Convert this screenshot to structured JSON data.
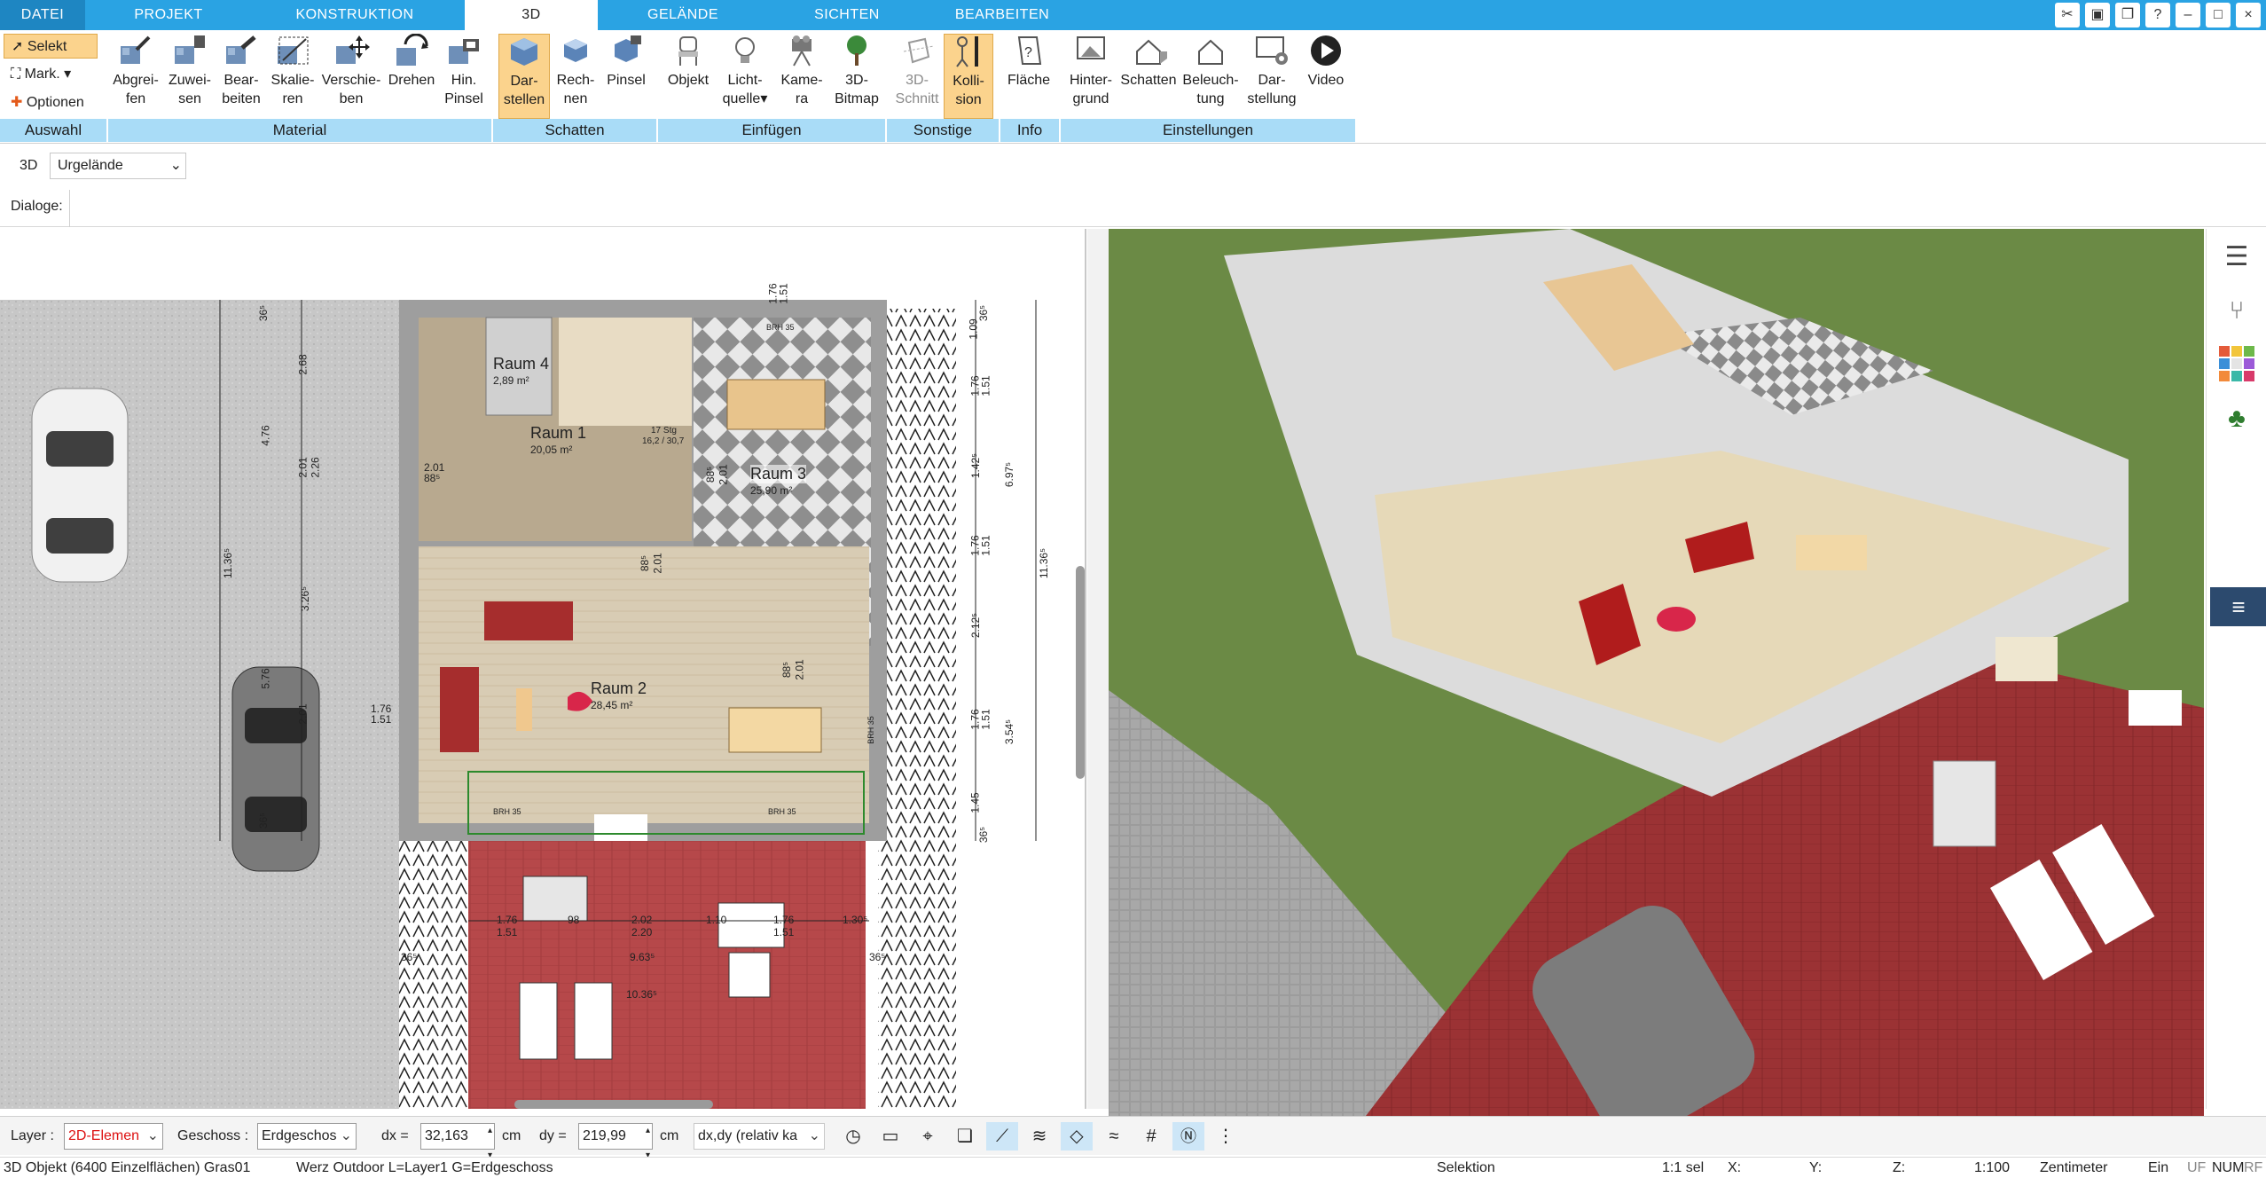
{
  "tabs": [
    {
      "label": "DATEI"
    },
    {
      "label": "PROJEKT"
    },
    {
      "label": "KONSTRUKTION"
    },
    {
      "label": "3D"
    },
    {
      "label": "GELÄNDE"
    },
    {
      "label": "SICHTEN"
    },
    {
      "label": "BEARBEITEN"
    }
  ],
  "selection": {
    "selekt": "Selekt",
    "mark": "Mark.",
    "optionen": "Optionen"
  },
  "ribbon": {
    "abgreifen": "Abgrei-\nfen",
    "zuweisen": "Zuwei-\nsen",
    "bearbeiten": "Bear-\nbeiten",
    "skalieren": "Skalie-\nren",
    "verschieben": "Verschie-\nben",
    "drehen": "Drehen",
    "hinpinsel": "Hin.\nPinsel",
    "darstellen": "Dar-\nstellen",
    "rechnen": "Rech-\nnen",
    "pinsel": "Pinsel",
    "objekt": "Objekt",
    "lichtquelle": "Licht-\nquelle",
    "kamera": "Kame-\nra",
    "bitmap3d": "3D-\nBitmap",
    "schnitt3d": "3D-\nSchnitt",
    "kollision": "Kolli-\nsion",
    "flaeche": "Fläche",
    "hintergrund": "Hinter-\ngrund",
    "schatten": "Schatten",
    "beleuchtung": "Beleuch-\ntung",
    "darstellung": "Dar-\nstellung",
    "video": "Video"
  },
  "groups": {
    "auswahl": "Auswahl",
    "material": "Material",
    "schatten": "Schatten",
    "einfuegen": "Einfügen",
    "sonstige": "Sonstige",
    "info": "Info",
    "einstellungen": "Einstellungen"
  },
  "viewbar": {
    "label": "3D",
    "select_value": "Urgelände"
  },
  "dialogbar": {
    "label": "Dialoge:"
  },
  "plan": {
    "rooms": [
      {
        "name": "Raum 4",
        "area": "2,89 m²"
      },
      {
        "name": "Raum 1",
        "area": "20,05 m²"
      },
      {
        "name": "Raum 3",
        "area": "25,90 m²"
      },
      {
        "name": "Raum 2",
        "area": "28,45 m²"
      }
    ],
    "dims_right": [
      "36⁵",
      "1.09",
      "1.76",
      "1.51",
      "1.42⁵",
      "6.97⁵",
      "1.76",
      "1.51",
      "11.36⁵",
      "2.12⁵",
      "1.76",
      "1.51",
      "3.54⁵",
      "1.45",
      "36⁵"
    ],
    "dims_left": [
      "36⁵",
      "2.68",
      "4.76",
      "2.01",
      "2.26",
      "11.36⁵",
      "3.26⁵",
      "5.76",
      "2.01",
      "36⁵"
    ],
    "dims_bottom": [
      "1.76",
      "1.51",
      "98",
      "2.02",
      "2.20",
      "1.10",
      "1.76",
      "1.51",
      "1.30⁵",
      "9.63⁵",
      "10.36⁵",
      "36⁵",
      "36⁵"
    ],
    "small_labels": [
      "BRH 35",
      "BRH 35",
      "BRH 35",
      "BRH 35",
      "88⁵",
      "2.01",
      "88⁵",
      "2.01",
      "88⁵",
      "2.01",
      "88⁵",
      "2.01",
      "17 Stg",
      "16,2 / 30,7",
      "1.76",
      "1.51",
      "1.76",
      "1.51"
    ]
  },
  "sidebar_right": {
    "icons": [
      "layers-icon",
      "chair-icon",
      "materials-icon",
      "tree-icon",
      "menu-icon"
    ]
  },
  "optbar": {
    "layer_label": "Layer :",
    "layer_value": "2D-Elemen",
    "geschoss_label": "Geschoss :",
    "geschoss_value": "Erdgeschos",
    "dx_label": "dx =",
    "dx_value": "32,163",
    "dx_unit": "cm",
    "dy_label": "dy =",
    "dy_value": "219,99",
    "dy_unit": "cm",
    "mode_value": "dx,dy (relativ ka"
  },
  "status": {
    "object": "3D Objekt (6400 Einzelflächen) Gras01",
    "info": "Werz Outdoor L=Layer1 G=Erdgeschoss",
    "mode": "Selektion",
    "scale": "1:1 sel",
    "x": "X:",
    "y": "Y:",
    "z": "Z:",
    "ratio": "1:100",
    "unit": "Zentimeter",
    "ein": "Ein",
    "uf": "UF",
    "num": "NUM",
    "rf": "RF"
  },
  "colors": {
    "accent": "#2aa3e3",
    "group_label_bg": "#a9dcf7",
    "active_btn": "#fbd38d",
    "terrace": "#a33a3a",
    "grass": "#5d7a3e"
  }
}
